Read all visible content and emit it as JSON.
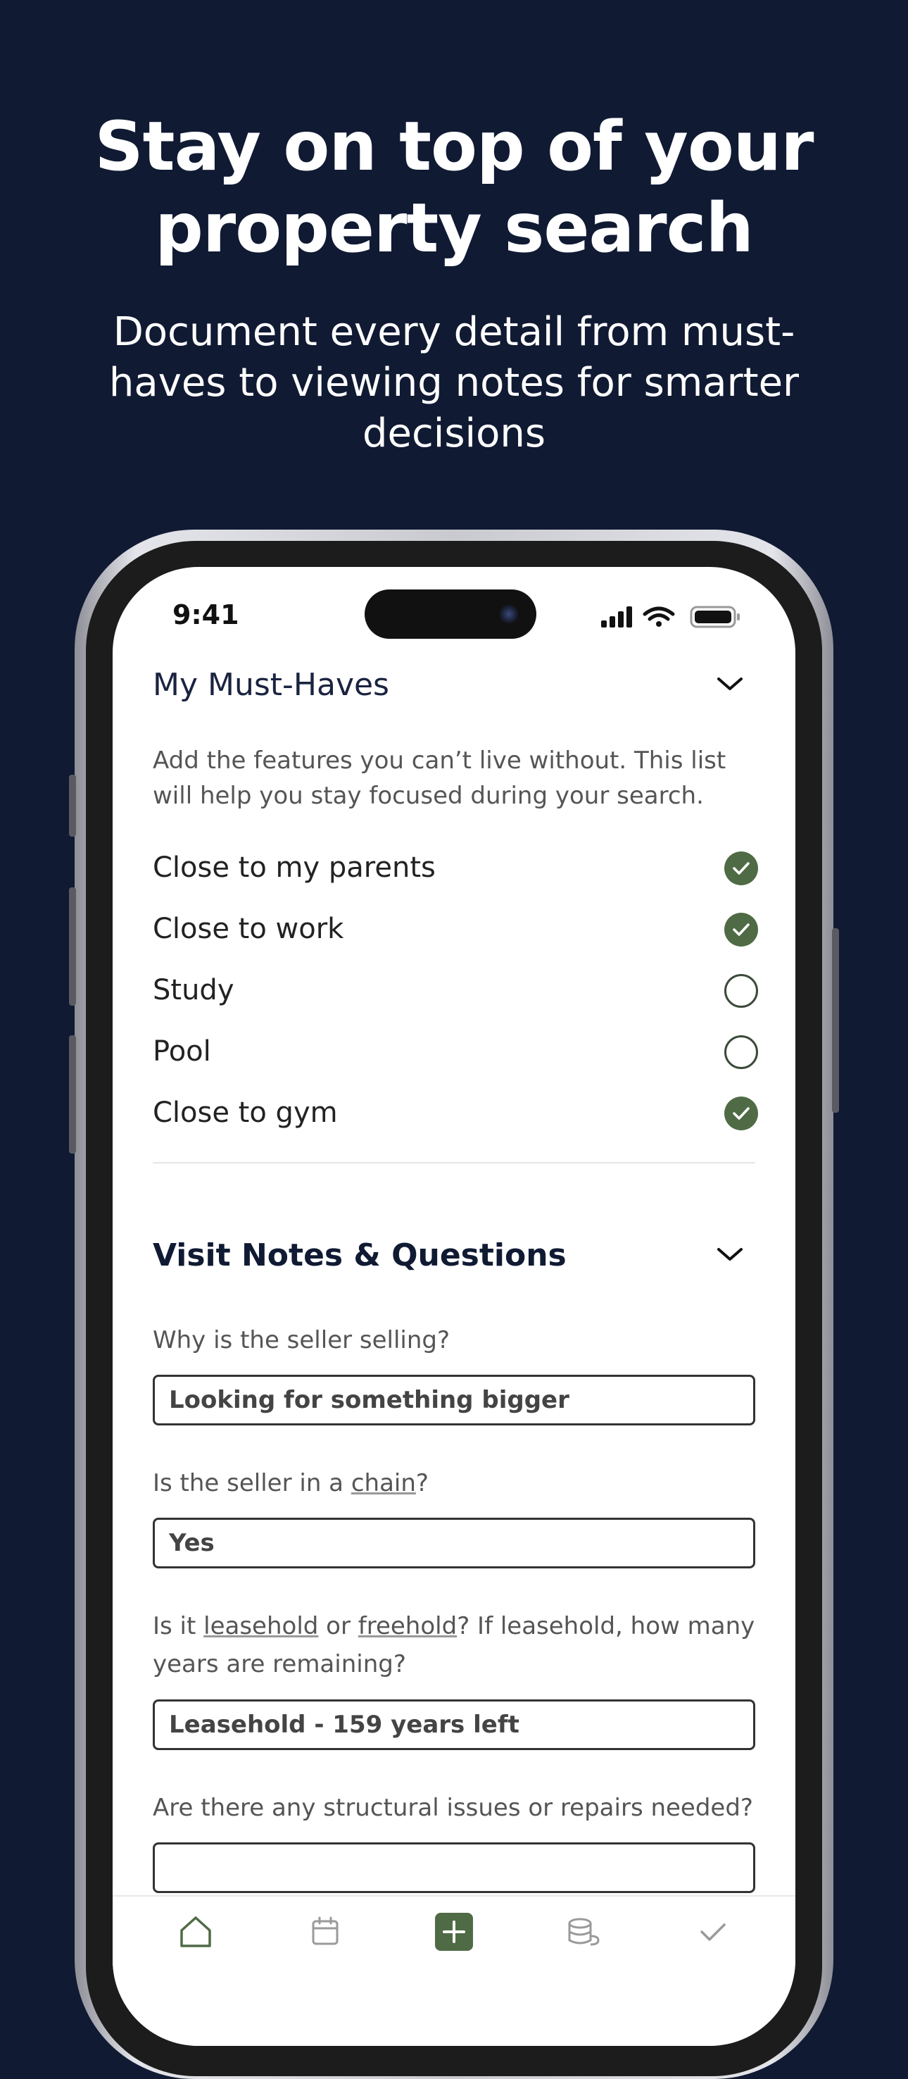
{
  "marketing": {
    "headline_line1": "Stay on top of your",
    "headline_line2": "property search",
    "subline": "Document every detail from must-haves to viewing notes for smarter decisions"
  },
  "status_bar": {
    "time": "9:41",
    "icons": [
      "signal-icon",
      "wifi-icon",
      "battery-icon"
    ]
  },
  "must_haves": {
    "title": "My Must-Haves",
    "description": "Add the features you can’t live without. This list will help you stay focused during your search.",
    "items": [
      {
        "label": "Close to my parents",
        "checked": true
      },
      {
        "label": "Close to work",
        "checked": true
      },
      {
        "label": "Study",
        "checked": false
      },
      {
        "label": "Pool",
        "checked": false
      },
      {
        "label": "Close to gym",
        "checked": true
      }
    ]
  },
  "visit_notes": {
    "title": "Visit Notes & Questions",
    "questions": [
      {
        "before": "Why is the seller selling?",
        "answer": "Looking for something bigger"
      },
      {
        "before": "Is the seller in a ",
        "link1": "chain",
        "after": "?",
        "answer": "Yes"
      },
      {
        "before": "Is it ",
        "link1": "leasehold",
        "middle": " or ",
        "link2": "freehold",
        "after": "? If leasehold, how many years are remaining?",
        "answer": "Leasehold - 159 years left"
      },
      {
        "before": "Are there any structural issues or repairs needed?",
        "answer": ""
      }
    ]
  },
  "tab_bar": {
    "tabs": [
      "home-icon",
      "calendar-icon",
      "add-icon",
      "coins-icon",
      "check-icon"
    ],
    "accent": "#4f6b45"
  },
  "colors": {
    "background": "#101a33",
    "accent": "#4f6b45"
  }
}
